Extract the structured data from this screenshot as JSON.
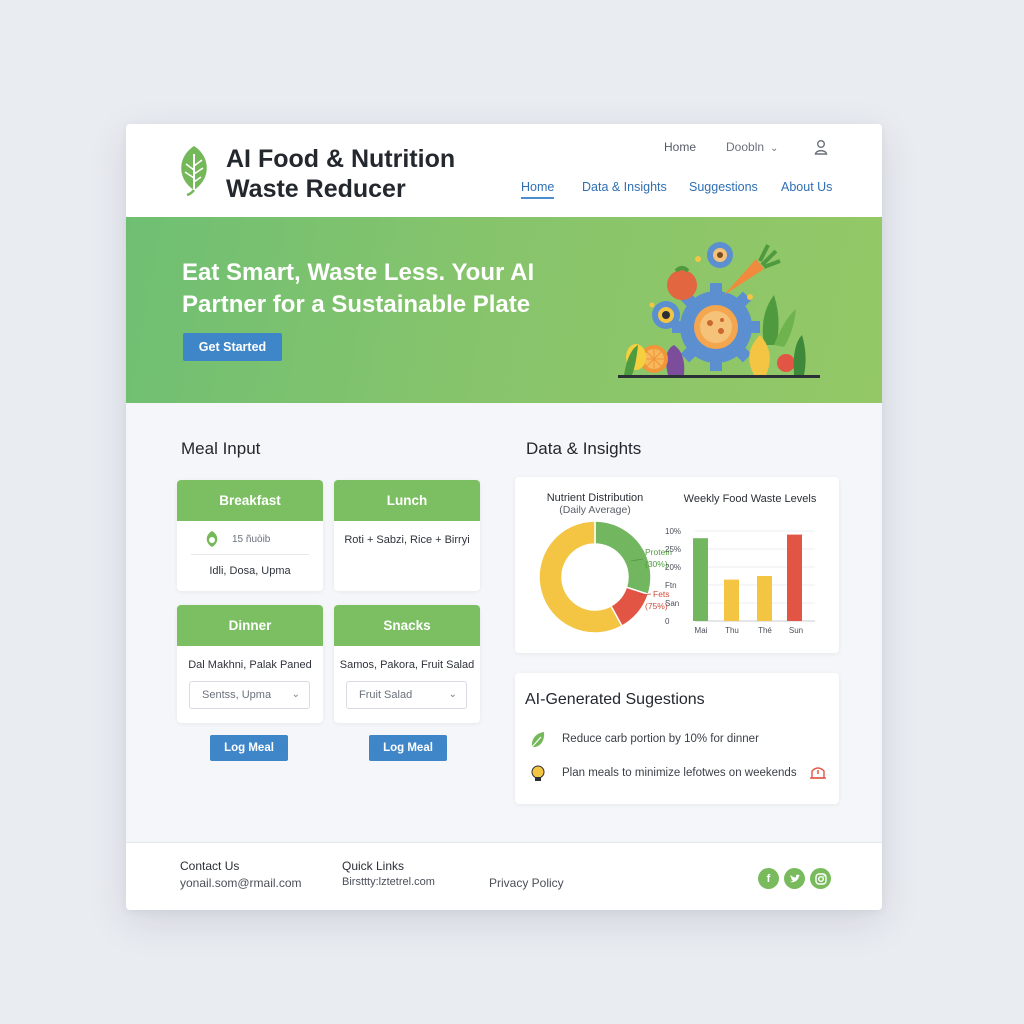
{
  "brand": {
    "line1": "AI Food & Nutrition",
    "line2": "Waste Reducer"
  },
  "topnav": {
    "home": "Home",
    "login": "Doobln"
  },
  "mainnav": {
    "items": [
      "Home",
      "Data & Insights",
      "Suggestions",
      "About Us"
    ],
    "active": "Home"
  },
  "hero": {
    "line1": "Eat Smart, Waste Less. Your AI",
    "line2": "Partner for a Sustainable Plate",
    "cta": "Get Started"
  },
  "meal_input": {
    "title": "Meal Input",
    "breakfast": {
      "label": "Breakfast",
      "badge": "15 ñuòib",
      "item": "Idli, Dosa, Upma"
    },
    "lunch": {
      "label": "Lunch",
      "item": "Roti + Sabzi, Rice + Birryi"
    },
    "dinner": {
      "label": "Dinner",
      "item": "Dal Makhni, Palak Paned",
      "select": "Sentss, Upma"
    },
    "snacks": {
      "label": "Snacks",
      "item": "Samos, Pakora, Fruit Salad",
      "select": "Fruit Salad"
    },
    "log_label": "Log Meal"
  },
  "insights": {
    "title": "Data & Insights",
    "nutrient_title": "Nutrient Distribution",
    "nutrient_sub": "(Daily Average)",
    "waste_title": "Weekly Food Waste Levels"
  },
  "chart_data": [
    {
      "type": "pie",
      "title": "Nutrient Distribution",
      "subtitle": "(Daily Average)",
      "slices": [
        {
          "label": "Protein",
          "value": 30,
          "display": "(30%)",
          "color": "#73b660"
        },
        {
          "label": "Fets",
          "value": 12,
          "display": "(75%)",
          "color": "#e25545"
        },
        {
          "label": "",
          "value": 58,
          "display": "",
          "color": "#f4c443"
        }
      ]
    },
    {
      "type": "bar",
      "title": "Weekly Food Waste Levels",
      "categories": [
        "Mai",
        "Thu",
        "Thé",
        "Sun"
      ],
      "y_tick_labels": [
        "10%",
        "25%",
        "20%",
        "Ftn",
        "San",
        "0"
      ],
      "bars": [
        {
          "category": "Mai",
          "value": 9.2,
          "color": "#73b660"
        },
        {
          "category": "Mai",
          "value": 4.6,
          "color": "#f4c443"
        },
        {
          "category": "Thu",
          "value": 4.6,
          "color": "#f4c443"
        },
        {
          "category": "Thé",
          "value": 5.0,
          "color": "#f4c443"
        },
        {
          "category": "Sun",
          "value": 9.6,
          "color": "#e25545"
        }
      ],
      "ylim": [
        0,
        10
      ],
      "grid": true
    }
  ],
  "suggestions": {
    "title": "AI-Generated Sugestions",
    "items": [
      {
        "icon": "leaf-icon",
        "text": "Reduce carb portion by 10% for dinner"
      },
      {
        "icon": "lightbulb-icon",
        "text": "Plan meals to minimize lefotwes on weekends"
      }
    ]
  },
  "footer": {
    "contact_label": "Contact Us",
    "contact_value": "yonail.som@rmail.com",
    "links_label": "Quick Links",
    "links_value": "Birsttty:lztetrel.com",
    "privacy": "Privacy Policy",
    "social": [
      "facebook-icon",
      "twitter-icon",
      "instagram-icon"
    ]
  },
  "colors": {
    "green": "#7cbf62",
    "blue": "#3f86c8",
    "yellow": "#f4c443",
    "red": "#e25545"
  }
}
